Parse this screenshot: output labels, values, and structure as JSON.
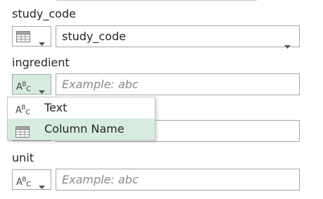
{
  "fields": [
    {
      "label": "study_code",
      "type_icon": "table-icon",
      "value": "study_code",
      "has_dropdown": true
    },
    {
      "label": "ingredient",
      "type_icon": "abc-icon",
      "placeholder": "Example: abc"
    },
    {
      "label": "",
      "type_icon": "",
      "placeholder": ""
    },
    {
      "label": "unit",
      "type_icon": "abc-icon",
      "placeholder": "Example: abc"
    }
  ],
  "type_menu": {
    "items": [
      {
        "label": "Text",
        "icon": "abc-icon",
        "selected": false
      },
      {
        "label": "Column Name",
        "icon": "table-icon",
        "selected": true
      }
    ]
  },
  "colors": {
    "border": "#a6a6a6",
    "selection": "#d6ecdf",
    "placeholder": "#8a8a8a"
  }
}
